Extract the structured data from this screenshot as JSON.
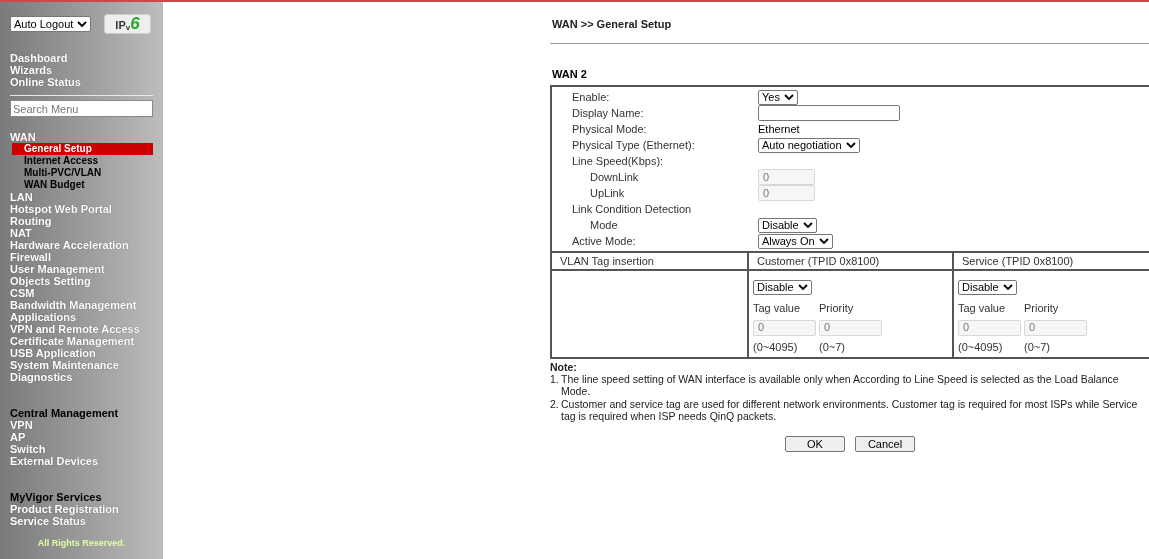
{
  "sidebar": {
    "logout_select": "Auto Logout",
    "ipv6_logo": {
      "prefix": "IP",
      "sub": "v",
      "suffix": "6"
    },
    "top_items": [
      {
        "label": "Dashboard",
        "kind": "top"
      },
      {
        "label": "Wizards",
        "kind": "top"
      },
      {
        "label": "Online Status",
        "kind": "top"
      }
    ],
    "search": {
      "placeholder": "Search Menu"
    },
    "menu_groups": [
      [
        {
          "label": "WAN",
          "kind": "top"
        },
        {
          "label": "General Setup",
          "kind": "sub",
          "selected": true
        },
        {
          "label": "Internet Access",
          "kind": "sub",
          "selected": false
        },
        {
          "label": "Multi-PVC/VLAN",
          "kind": "sub",
          "selected": false
        },
        {
          "label": "WAN Budget",
          "kind": "sub",
          "selected": false
        },
        {
          "label": "LAN",
          "kind": "top"
        },
        {
          "label": "Hotspot Web Portal",
          "kind": "top"
        },
        {
          "label": "Routing",
          "kind": "top"
        },
        {
          "label": "NAT",
          "kind": "top"
        },
        {
          "label": "Hardware Acceleration",
          "kind": "top"
        },
        {
          "label": "Firewall",
          "kind": "top"
        },
        {
          "label": "User Management",
          "kind": "top"
        },
        {
          "label": "Objects Setting",
          "kind": "top"
        },
        {
          "label": "CSM",
          "kind": "top"
        },
        {
          "label": "Bandwidth Management",
          "kind": "top"
        },
        {
          "label": "Applications",
          "kind": "top"
        },
        {
          "label": "VPN and Remote Access",
          "kind": "top"
        },
        {
          "label": "Certificate Management",
          "kind": "top"
        },
        {
          "label": "USB Application",
          "kind": "top"
        },
        {
          "label": "System Maintenance",
          "kind": "top"
        },
        {
          "label": "Diagnostics",
          "kind": "top"
        }
      ],
      [
        {
          "label": "Central Management",
          "kind": "heading"
        },
        {
          "label": "VPN",
          "kind": "top"
        },
        {
          "label": "AP",
          "kind": "top"
        },
        {
          "label": "Switch",
          "kind": "top"
        },
        {
          "label": "External Devices",
          "kind": "top"
        }
      ],
      [
        {
          "label": "MyVigor Services",
          "kind": "heading"
        },
        {
          "label": "Product Registration",
          "kind": "top"
        },
        {
          "label": "Service Status",
          "kind": "top"
        }
      ]
    ],
    "footer": "All Rights Reserved."
  },
  "main": {
    "breadcrumb": "WAN >> General Setup",
    "section_title": "WAN 2",
    "rows": [
      {
        "label": "Enable:",
        "kind": "select",
        "value": "Yes",
        "indent": false
      },
      {
        "label": "Display Name:",
        "kind": "input",
        "value": "",
        "indent": false
      },
      {
        "label": "Physical Mode:",
        "kind": "text",
        "value": "Ethernet",
        "indent": false
      },
      {
        "label": "Physical Type (Ethernet):",
        "kind": "select",
        "value": "Auto negotiation",
        "indent": false
      },
      {
        "label": "Line Speed(Kbps):",
        "kind": "label",
        "indent": false
      },
      {
        "label": "DownLink",
        "kind": "disabled_input",
        "value": "0",
        "indent": true
      },
      {
        "label": "UpLink",
        "kind": "disabled_input",
        "value": "0",
        "indent": true
      },
      {
        "label": "Link Condition Detection",
        "kind": "label",
        "indent": false
      },
      {
        "label": "Mode",
        "kind": "select",
        "value": "Disable",
        "indent": true
      },
      {
        "label": "Active Mode:",
        "kind": "select",
        "value": "Always On",
        "indent": false
      }
    ],
    "vlan": {
      "label": "VLAN Tag insertion",
      "columns": [
        {
          "title": "Customer (TPID 0x8100)",
          "select": "Disable",
          "tag_label": "Tag value",
          "priority_label": "Priority",
          "tag_value": "0",
          "priority_value": "0",
          "tag_range": "(0~4095)",
          "priority_range": "(0~7)"
        },
        {
          "title": "Service (TPID 0x8100)",
          "select": "Disable",
          "tag_label": "Tag value",
          "priority_label": "Priority",
          "tag_value": "0",
          "priority_value": "0",
          "tag_range": "(0~4095)",
          "priority_range": "(0~7)"
        }
      ]
    },
    "note_title": "Note:",
    "notes": [
      "The line speed setting of WAN interface is available only when According to Line Speed is selected as the Load Balance Mode.",
      "Customer and service tag are used for different network environments. Customer tag is required for most ISPs while Service tag is required when ISP needs QinQ packets."
    ],
    "note_numbers": [
      "1.",
      "2."
    ],
    "buttons": [
      "OK",
      "Cancel"
    ]
  }
}
